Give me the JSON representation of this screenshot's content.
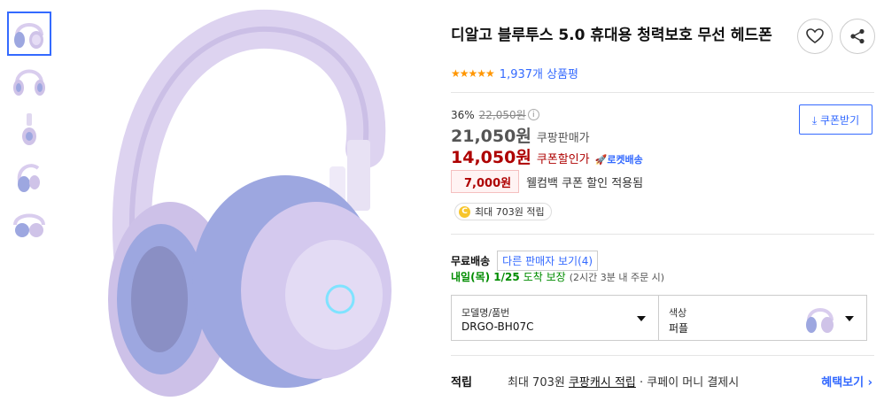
{
  "product": {
    "title": "디알고 블루투스 5.0 휴대용 청력보호 무선 헤드폰",
    "rating_count": "1,937개 상품평",
    "stars": "★★★★★"
  },
  "actions": {
    "favorite_icon": "heart-icon",
    "share_icon": "share-icon"
  },
  "pricing": {
    "discount_rate": "36%",
    "original_price": "22,050원",
    "info_glyph": "i",
    "sale_price": "21,050원",
    "sale_label": "쿠팡판매가",
    "coupon_price": "14,050원",
    "coupon_label": "쿠폰할인가",
    "rocket_label": "🚀로켓배송",
    "coupon_button": "⤓ 쿠폰받기",
    "welcome_amount": "7,000원",
    "welcome_text": "웰컴백 쿠폰 할인 적용됨",
    "reward_glyph": "C",
    "reward_text": "최대 703원 적립"
  },
  "shipping": {
    "label": "무료배송",
    "other_sellers": "다른 판매자 보기(4)",
    "date": "내일(목) 1/25",
    "guarantee": "도착 보장",
    "note": "(2시간 3분 내 주문 시)"
  },
  "options": {
    "model_label": "모델명/품번",
    "model_value": "DRGO-BH07C",
    "color_label": "색상",
    "color_value": "퍼플"
  },
  "points": {
    "label": "적립",
    "text_prefix": "최대 703원 ",
    "link": "쿠팡캐시 적립",
    "text_suffix": " · 쿠페이 머니 결제시",
    "benefit_link": "혜택보기 ›"
  },
  "colors": {
    "accent": "#346aff",
    "coupon_red": "#ae0000",
    "delivery_green": "#008c00",
    "star_orange": "#ff9600",
    "product_lavender": "#d9cdee",
    "cushion_periwinkle": "#9da7e0"
  }
}
